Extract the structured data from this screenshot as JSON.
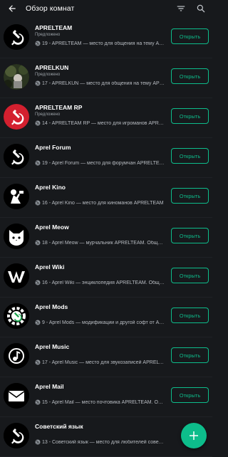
{
  "header": {
    "title": "Обзор комнат",
    "back_icon": "arrow-left-icon",
    "filter_icon": "filter-icon",
    "search_icon": "search-icon"
  },
  "colors": {
    "background": "#17191c",
    "accent": "#0dbd8b",
    "row_divider": "#1f2226"
  },
  "rooms": [
    {
      "name": "APRELTEAM",
      "tag": "Предложено",
      "members": "19",
      "desc": "19 - APRELTEAM — место для общения на тему APRELTEAM",
      "button": "Открыть",
      "avatar_icon": "hammer-sickle-icon"
    },
    {
      "name": "APRELKUN",
      "tag": "Предложено",
      "members": "17",
      "desc": "17 - APRELKUN — место для общения на тему APRELKUN",
      "button": "Открыть",
      "avatar_icon": "photo-avatar"
    },
    {
      "name": "APRELTEAM RP",
      "tag": "Предложено",
      "members": "14",
      "desc": "14 - APRELTEAM RP — место для игроманов APRELTEAM",
      "button": "Открыть",
      "avatar_icon": "hammer-sickle-red-icon"
    },
    {
      "name": "Aprel Forum",
      "tag": "",
      "members": "19",
      "desc": "19 - Aprel Forum — место для форумчан APRELTEAM",
      "button": "Открыть",
      "avatar_icon": "hammer-sickle-icon"
    },
    {
      "name": "Aprel Kino",
      "tag": "",
      "members": "16",
      "desc": "16 - Aprel Kino — место для киноманов APRELTEAM",
      "button": "Открыть",
      "avatar_icon": "kino-icon"
    },
    {
      "name": "Aprel Meow",
      "tag": "",
      "members": "18",
      "desc": "18 - Aprel Meow — мурчальник APRELTEAM. Общение",
      "button": "Открыть",
      "avatar_icon": "cat-icon"
    },
    {
      "name": "Aprel Wiki",
      "tag": "",
      "members": "16",
      "desc": "16 - Aprel Wiki — энциклопедия APRELTEAM. Общение",
      "button": "Открыть",
      "avatar_icon": "wiki-icon"
    },
    {
      "name": "Aprel Mods",
      "tag": "",
      "members": "9",
      "desc": "9 - Aprel Mods — модификации и другой софт от APRELTEAM",
      "button": "Открыть",
      "avatar_icon": "gear-sickle-icon"
    },
    {
      "name": "Aprel Music",
      "tag": "",
      "members": "17",
      "desc": "17 - Aprel Music — место для звукозаписей APRELTEAM",
      "button": "Открыть",
      "avatar_icon": "music-icon"
    },
    {
      "name": "Aprel Mail",
      "tag": "",
      "members": "15",
      "desc": "15 - Aprel Mail — место почтовика APRELTEAM. Общение",
      "button": "Открыть",
      "avatar_icon": "mail-icon"
    },
    {
      "name": "Советский язык",
      "tag": "",
      "members": "13",
      "desc": "13 - Советский язык — место для любителей советского языка",
      "button": "",
      "avatar_icon": "hammer-sickle-icon"
    }
  ],
  "fab": {
    "icon": "plus-icon"
  }
}
